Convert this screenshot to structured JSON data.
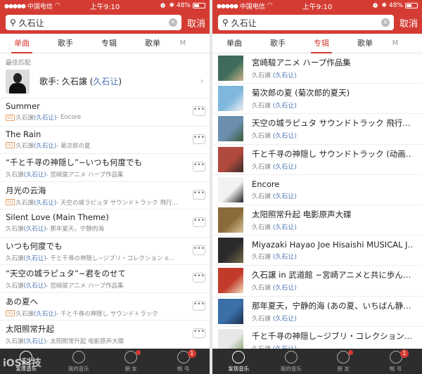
{
  "status": {
    "carrier": "中国电信",
    "time": "上午9:10",
    "battery": "48%",
    "battery_level": 0.48
  },
  "search": {
    "query": "久石让",
    "cancel": "取消"
  },
  "tabs": [
    "单曲",
    "歌手",
    "专辑",
    "歌单",
    "M"
  ],
  "left": {
    "active_tab": "单曲",
    "best_match_label": "最佳匹配",
    "artist_prefix": "歌手: 久石譲 (",
    "artist_alias": "久石让",
    "artist_suffix": ")",
    "songs": [
      {
        "title": "Summer",
        "artist": "久石譲",
        "alias": "(久石让)",
        "album": " - Encore",
        "sq": true
      },
      {
        "title": "The Rain",
        "artist": "久石譲",
        "alias": "(久石让)",
        "album": " - 菊次郎の夏",
        "sq": true
      },
      {
        "title": "“千と千寻の神隠し”~いつも何度でも",
        "artist": "久石譲",
        "alias": "(久石让)",
        "album": " - 宫崎骏アニメ ハープ作品集",
        "sq": false
      },
      {
        "title": "月光の云海",
        "artist": "久石譲",
        "alias": "(久石让)",
        "album": " - 天空の城ラピュタ サウンドトラック 飛行…",
        "sq": true
      },
      {
        "title": "Silent Love (Main Theme)",
        "artist": "久石譲",
        "alias": "(久石让)",
        "album": " - 那年夏天，宁静的海",
        "sq": false
      },
      {
        "title": "いつも何度でも",
        "artist": "久石譲",
        "alias": "(久石让)",
        "album": " - 千と千尋の神隠し~ジブリ・コレクション o…",
        "sq": false
      },
      {
        "title": "“天空の城ラピュタ”~君をのせて",
        "artist": "久石譲",
        "alias": "(久石让)",
        "album": " - 宫崎骏アニメ ハープ作品集",
        "sq": false
      },
      {
        "title": "あの夏へ",
        "artist": "久石譲",
        "alias": "(久石让)",
        "album": " - 千と千尋の神隠し サウンドトラック",
        "sq": true
      },
      {
        "title": "太阳照常升起",
        "artist": "久石譲",
        "alias": "(久石让)",
        "album": " - 太阳照常升起 电影原声大碟",
        "sq": false
      }
    ]
  },
  "right": {
    "active_tab": "专辑",
    "albums": [
      {
        "title": "宮崎駿アニメ ハープ作品集",
        "artist": "久石譲",
        "alias": "(久石让)",
        "cover_color": "#3f6b5a",
        "cover_color2": "#c9b48a"
      },
      {
        "title": "菊次郎の夏 (菊次郎的夏天)",
        "artist": "久石譲",
        "alias": "(久石让)",
        "cover_color": "#7fb7dd",
        "cover_color2": "#f2f2f2"
      },
      {
        "title": "天空の城ラピュタ サウンドトラック 飛行…",
        "artist": "久石譲",
        "alias": "(久石让)",
        "cover_color": "#6c8fb0",
        "cover_color2": "#3c5a3a"
      },
      {
        "title": "千と千寻の神隠し サウンドトラック (动画…",
        "artist": "久石譲",
        "alias": "(久石让)",
        "cover_color": "#b04a3c",
        "cover_color2": "#3a2a2a"
      },
      {
        "title": "Encore",
        "artist": "久石譲",
        "alias": "(久石让)",
        "cover_color": "#f2f2f2",
        "cover_color2": "#222222"
      },
      {
        "title": "太阳照常升起 电影原声大碟",
        "artist": "久石譲",
        "alias": "(久石让)",
        "cover_color": "#8a6a3a",
        "cover_color2": "#d9c59a"
      },
      {
        "title": "Miyazaki Hayao Joe Hisaishi MUSICAL J…",
        "artist": "久石譲",
        "alias": "(久石让)",
        "cover_color": "#2b2b2b",
        "cover_color2": "#7a6a4a"
      },
      {
        "title": "久石譲 in 武道館 ~宮崎アニメと共に歩ん…",
        "artist": "久石譲",
        "alias": "(久石让)",
        "cover_color": "#c23a2a",
        "cover_color2": "#f0e0c0"
      },
      {
        "title": "那年夏天，宁静的海 (あの夏、いちばん静…",
        "artist": "久石譲",
        "alias": "(久石让)",
        "cover_color": "#3a6fa8",
        "cover_color2": "#1c2f4a"
      },
      {
        "title": "千と千寻の神隠し~ジブリ・コレクション…",
        "artist": "久石譲",
        "alias": "(久石让)",
        "cover_color": "#e8e8e8",
        "cover_color2": "#7a9a5a"
      }
    ]
  },
  "bottom_nav": [
    {
      "label": "发现音乐",
      "icon": "music-note-icon",
      "active": true,
      "badge": "",
      "dot": false
    },
    {
      "label": "我的音乐",
      "icon": "music-library-icon",
      "active": false,
      "badge": "",
      "dot": false
    },
    {
      "label": "朋 友",
      "icon": "friends-icon",
      "active": false,
      "badge": "",
      "dot": true
    },
    {
      "label": "帐 号",
      "icon": "account-icon",
      "active": false,
      "badge": "1",
      "dot": false
    }
  ],
  "watermark": "iOS科技"
}
